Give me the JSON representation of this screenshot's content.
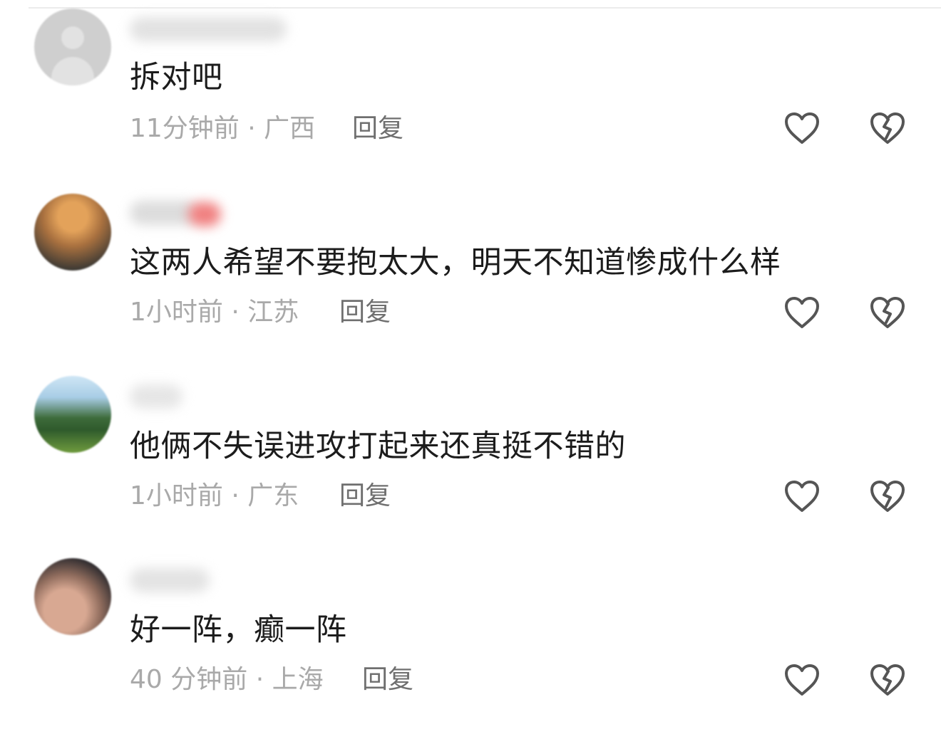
{
  "comments": [
    {
      "text": "拆对吧",
      "time": "11分钟前",
      "location": "广西",
      "reply_label": "回复"
    },
    {
      "text": "这两人希望不要抱太大，明天不知道惨成什么样",
      "time": "1小时前",
      "location": "江苏",
      "reply_label": "回复"
    },
    {
      "text": "他俩不失误进攻打起来还真挺不错的",
      "time": "1小时前",
      "location": "广东",
      "reply_label": "回复"
    },
    {
      "text": "好一阵，癫一阵",
      "time": "40 分钟前",
      "location": "上海",
      "reply_label": "回复"
    }
  ],
  "meta_separator": " · ",
  "icons": {
    "like": "heart-outline-icon",
    "dislike": "broken-heart-outline-icon"
  },
  "colors": {
    "text": "#1c1c1c",
    "meta": "#a9a9a9",
    "reply": "#6f6f6f",
    "icon": "#555555"
  }
}
